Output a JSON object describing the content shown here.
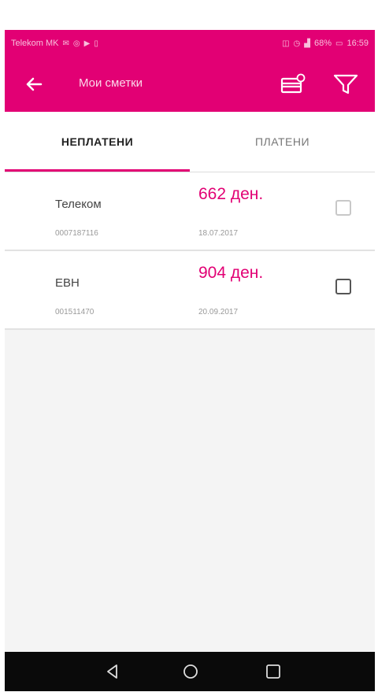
{
  "statusbar": {
    "carrier": "Telekom MK",
    "battery": "68%",
    "time": "16:59"
  },
  "appbar": {
    "back_icon": "arrow-left-icon",
    "title": "Мои сметки",
    "card_icon": "credit-card-icon",
    "filter_icon": "filter-icon"
  },
  "tabs": [
    {
      "label": "НЕПЛАТЕНИ",
      "active": true
    },
    {
      "label": "ПЛАТЕНИ",
      "active": false
    }
  ],
  "bills": [
    {
      "name": "Телеком",
      "account": "0007187116",
      "amount": "662 ден.",
      "date": "18.07.2017",
      "checked": false
    },
    {
      "name": "ЕВН",
      "account": "001511470",
      "amount": "904 ден.",
      "date": "20.09.2017",
      "checked": false
    }
  ],
  "colors": {
    "brand": "#e20074",
    "navbar": "#0a0a0a"
  },
  "navbar": {
    "back_icon": "triangle-back-icon",
    "home_icon": "circle-home-icon",
    "recents_icon": "square-recents-icon"
  }
}
